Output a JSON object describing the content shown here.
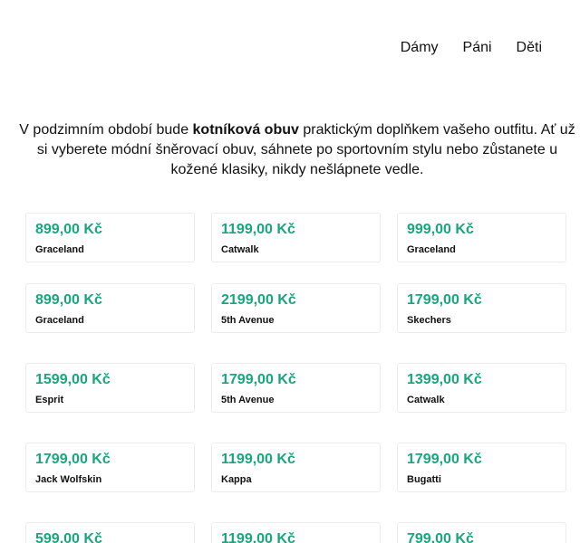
{
  "nav": {
    "items": [
      {
        "label": "Dámy"
      },
      {
        "label": "Páni"
      },
      {
        "label": "Děti"
      }
    ]
  },
  "intro": {
    "text_before": "V podzimním období bude ",
    "highlight": "kotníková obuv",
    "text_after": " praktickým doplňkem vašeho outfitu. Ať už si vyberete módní šněrovací obuv, sáhnete po sportovním stylu nebo zůstanete u kožené klasiky, nikdy nešlápnete vedle."
  },
  "products": [
    {
      "price": "899,00 Kč",
      "brand": "Graceland"
    },
    {
      "price": "1199,00 Kč",
      "brand": "Catwalk"
    },
    {
      "price": "999,00 Kč",
      "brand": "Graceland"
    },
    {
      "price": "899,00 Kč",
      "brand": "Graceland"
    },
    {
      "price": "2199,00 Kč",
      "brand": "5th Avenue"
    },
    {
      "price": "1799,00 Kč",
      "brand": "Skechers"
    },
    {
      "price": "1599,00 Kč",
      "brand": "Esprit"
    },
    {
      "price": "1799,00 Kč",
      "brand": "5th Avenue"
    },
    {
      "price": "1399,00 Kč",
      "brand": "Catwalk"
    },
    {
      "price": "1799,00 Kč",
      "brand": "Jack Wolfskin"
    },
    {
      "price": "1199,00 Kč",
      "brand": "Kappa"
    },
    {
      "price": "1799,00 Kč",
      "brand": "Bugatti"
    },
    {
      "price": "599,00 Kč",
      "brand": ""
    },
    {
      "price": "1199,00 Kč",
      "brand": ""
    },
    {
      "price": "799,00 Kč",
      "brand": ""
    }
  ],
  "colors": {
    "price": "#19a67e",
    "card_border": "#ececec",
    "text": "#111111"
  }
}
